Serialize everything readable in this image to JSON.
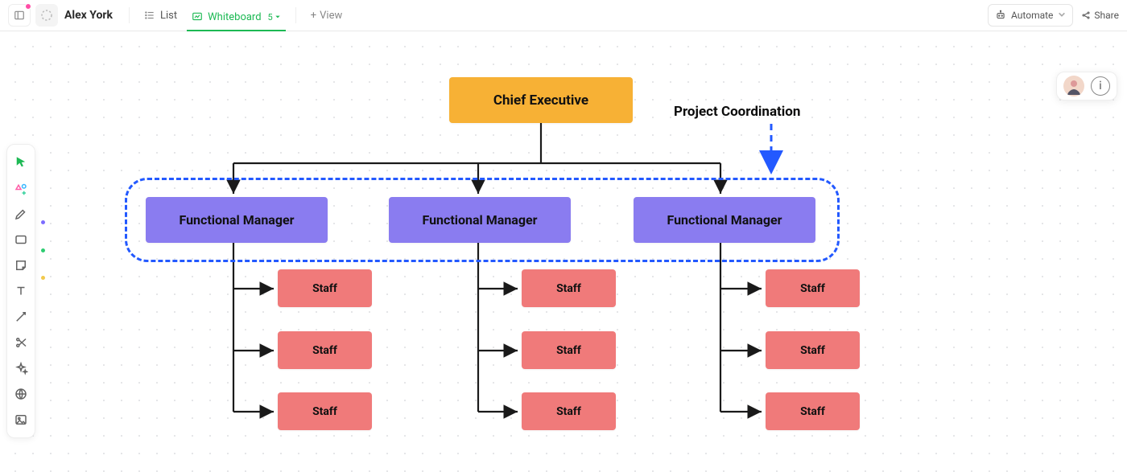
{
  "header": {
    "doc_title": "Alex York",
    "views": {
      "list_label": "List",
      "whiteboard_label": "Whiteboard",
      "whiteboard_count": "5",
      "add_view_label": "View"
    },
    "automate_label": "Automate",
    "share_label": "Share"
  },
  "floating": {
    "info_glyph": "i"
  },
  "diagram": {
    "ceo": "Chief Executive",
    "project_label": "Project Coordination",
    "managers": [
      "Functional Manager",
      "Functional Manager",
      "Functional Manager"
    ],
    "staff_label": "Staff"
  },
  "toolbar": {
    "tools": [
      {
        "name": "cursor",
        "active": true
      },
      {
        "name": "shapes-plus",
        "active": false
      },
      {
        "name": "pen",
        "active": false
      },
      {
        "name": "rectangle",
        "active": false
      },
      {
        "name": "sticky-note",
        "active": false
      },
      {
        "name": "text",
        "active": false
      },
      {
        "name": "connector",
        "active": false
      },
      {
        "name": "scissors",
        "active": false
      },
      {
        "name": "sparkle",
        "active": false
      },
      {
        "name": "globe",
        "active": false
      },
      {
        "name": "image",
        "active": false
      }
    ]
  }
}
